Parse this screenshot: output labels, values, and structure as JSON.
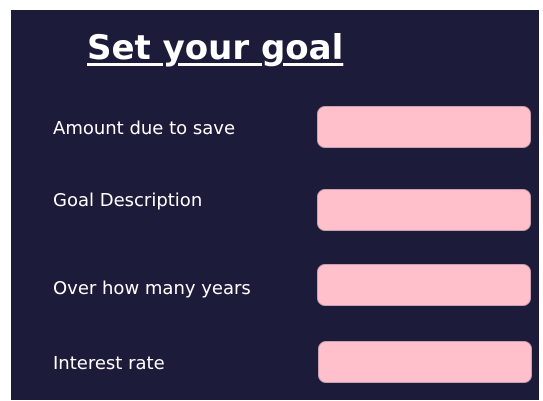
{
  "form": {
    "title": "Set your goal",
    "fields": [
      {
        "label": "Amount due to save",
        "value": ""
      },
      {
        "label": "Goal Description",
        "value": ""
      },
      {
        "label": "Over how many years",
        "value": ""
      },
      {
        "label": "Interest rate",
        "value": ""
      }
    ]
  },
  "colors": {
    "background": "#1c1c3a",
    "input_fill": "#ffc0cb",
    "text": "#ffffff"
  }
}
